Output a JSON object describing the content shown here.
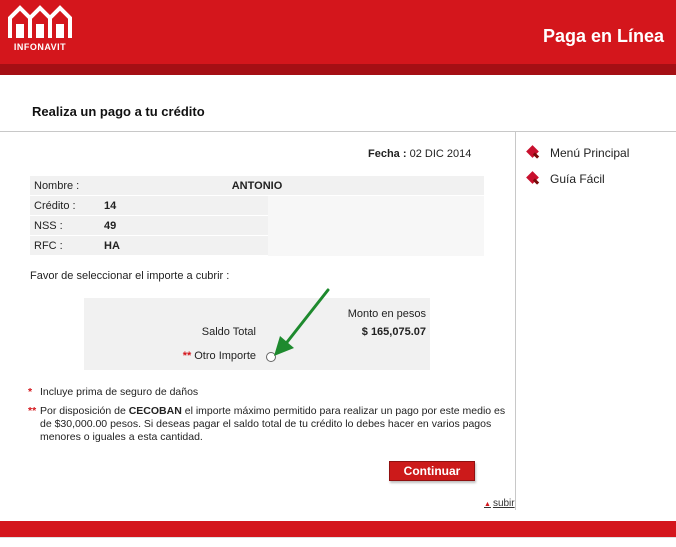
{
  "header": {
    "logo_text": "INFONAVIT",
    "title": "Paga en Línea"
  },
  "page": {
    "heading": "Realiza un pago a tu crédito"
  },
  "side_menu": {
    "items": [
      {
        "label": "Menú Principal"
      },
      {
        "label": "Guía Fácil"
      }
    ]
  },
  "date": {
    "label": "Fecha :",
    "value": "02 DIC 2014"
  },
  "info": {
    "rows": [
      {
        "key": "Nombre :",
        "value": "ANTONIO"
      },
      {
        "key": "Crédito :",
        "value": "14"
      },
      {
        "key": "NSS :",
        "value": "49"
      },
      {
        "key": "RFC :",
        "value": "HA"
      }
    ]
  },
  "selection": {
    "instruction": "Favor de seleccionar el importe a cubrir :",
    "column_header": "Monto en pesos",
    "saldo_label": "Saldo Total",
    "saldo_value": "$ 165,075.07",
    "otro_marker": "**",
    "otro_label": "Otro Importe"
  },
  "notes": {
    "note1_marker": "*",
    "note1_text": "Incluye prima de seguro de daños",
    "note2_marker": "**",
    "note2_prefix": "Por disposición de ",
    "note2_bold": "CECOBAN",
    "note2_text": " el importe máximo permitido para realizar un pago por este medio es de $30,000.00 pesos. Si deseas pagar el saldo total de tu crédito lo debes hacer en varios pagos menores o iguales a esta cantidad."
  },
  "actions": {
    "continue_label": "Continuar",
    "top_link": "subir"
  },
  "colors": {
    "brand_red": "#d4161c",
    "arrow_green": "#1e8a2e"
  }
}
